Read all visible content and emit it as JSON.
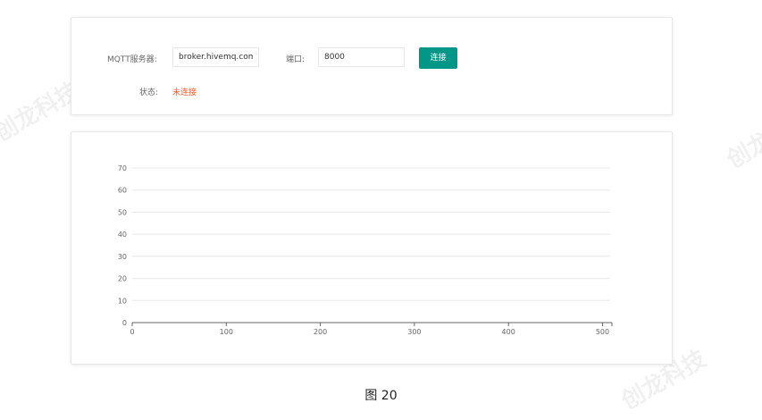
{
  "connection": {
    "server_label": "MQTT服务器:",
    "server_value": "broker.hivemq.com",
    "port_label": "端口:",
    "port_value": "8000",
    "connect_button": "连接",
    "status_label": "状态:",
    "status_value": "未连接",
    "status_color": "#ff5722",
    "accent_color": "#009688"
  },
  "chart_data": {
    "type": "line",
    "title": "",
    "xlabel": "",
    "ylabel": "",
    "xlim": [
      0,
      510
    ],
    "ylim": [
      0,
      70
    ],
    "x_ticks": [
      0,
      100,
      200,
      300,
      400,
      500
    ],
    "y_ticks": [
      0,
      10,
      20,
      30,
      40,
      50,
      60,
      70
    ],
    "grid": true,
    "series": []
  },
  "watermark": "创龙科技",
  "caption": "图  20"
}
